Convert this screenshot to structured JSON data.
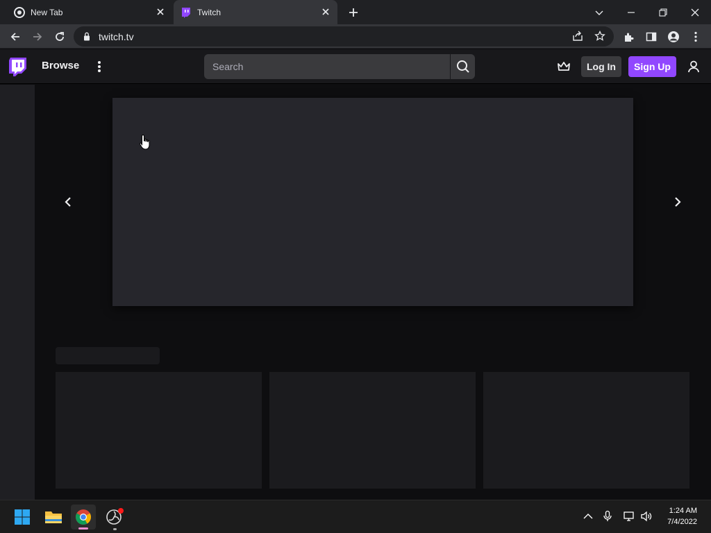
{
  "browser": {
    "tabs": [
      {
        "title": "New Tab",
        "icon": "chrome-icon",
        "active": false
      },
      {
        "title": "Twitch",
        "icon": "twitch-icon",
        "active": true
      }
    ],
    "address": "twitch.tv"
  },
  "twitch": {
    "nav": {
      "browse_label": "Browse"
    },
    "search": {
      "placeholder": "Search"
    },
    "login_label": "Log In",
    "signup_label": "Sign Up",
    "colors": {
      "brand": "#9147ff",
      "header_bg": "#18181b",
      "page_bg": "#0e0e10"
    }
  },
  "taskbar": {
    "time": "1:24 AM",
    "date": "7/4/2022"
  }
}
